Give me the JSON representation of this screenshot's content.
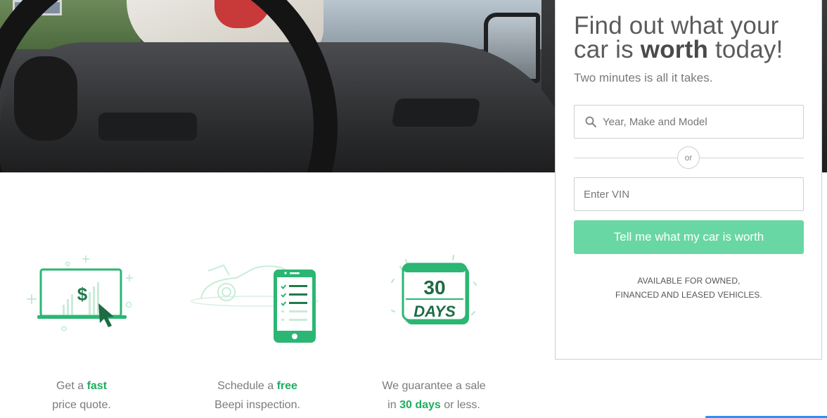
{
  "panel": {
    "headline_part1": "Find out what your",
    "headline_part2": "car is",
    "headline_bold": "worth",
    "headline_part3": "today!",
    "subhead": "Two minutes is all it takes.",
    "search_placeholder": "Year, Make and Model",
    "or_label": "or",
    "vin_placeholder": "Enter VIN",
    "cta_label": "Tell me what my car is worth",
    "availability_line1": "AVAILABLE FOR OWNED,",
    "availability_line2": "FINANCED AND LEASED VEHICLES."
  },
  "features": [
    {
      "pre": "Get a",
      "highlight": "fast",
      "post": "price quote.",
      "icon": "laptop-price-icon"
    },
    {
      "pre": "Schedule a",
      "highlight": "free",
      "post": "Beepi inspection.",
      "icon": "phone-checklist-icon"
    },
    {
      "pre": "We guarantee a sale",
      "mid": "in",
      "highlight": "30 days",
      "post": "or less.",
      "icon": "calendar-30-days-icon"
    }
  ],
  "icons": {
    "calendar_number": "30",
    "calendar_text": "DAYS",
    "laptop_symbol": "$"
  },
  "colors": {
    "accent_green": "#1fae5f",
    "cta_green": "#69d7a3",
    "corner_blue": "#2e8ef7"
  }
}
